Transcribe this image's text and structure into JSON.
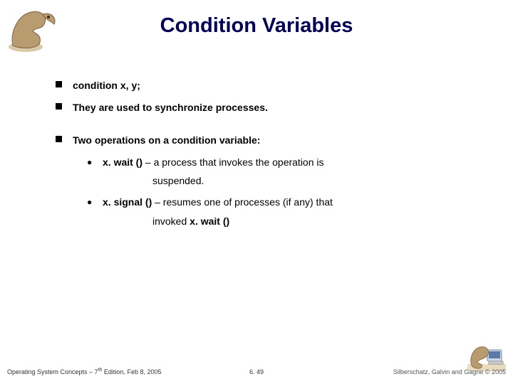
{
  "title": "Condition Variables",
  "bullets": {
    "b1": {
      "text": "condition x, y;"
    },
    "b2": {
      "text": "They are used to synchronize processes."
    },
    "b3": {
      "text": "Two operations on a condition variable:"
    }
  },
  "subs": {
    "s1_lead": "x. wait ()",
    "s1_rest": " – a process that invokes the operation is",
    "s1_cont": "suspended.",
    "s2_lead": "x. signal ()",
    "s2_rest": " – resumes one of processes (if any) that",
    "s2_cont_pre": "invoked ",
    "s2_cont_bold": "x. wait ()"
  },
  "footer": {
    "left_pre": "Operating System Concepts – 7",
    "left_sup": "th",
    "left_post": " Edition, Feb 8, 2005",
    "center": "6. 49",
    "right": "Silberschatz, Galvin and Gagne © 2005"
  },
  "icons": {
    "logo_tl": "dinosaur-logo",
    "logo_br": "dinosaur-computer-logo"
  }
}
